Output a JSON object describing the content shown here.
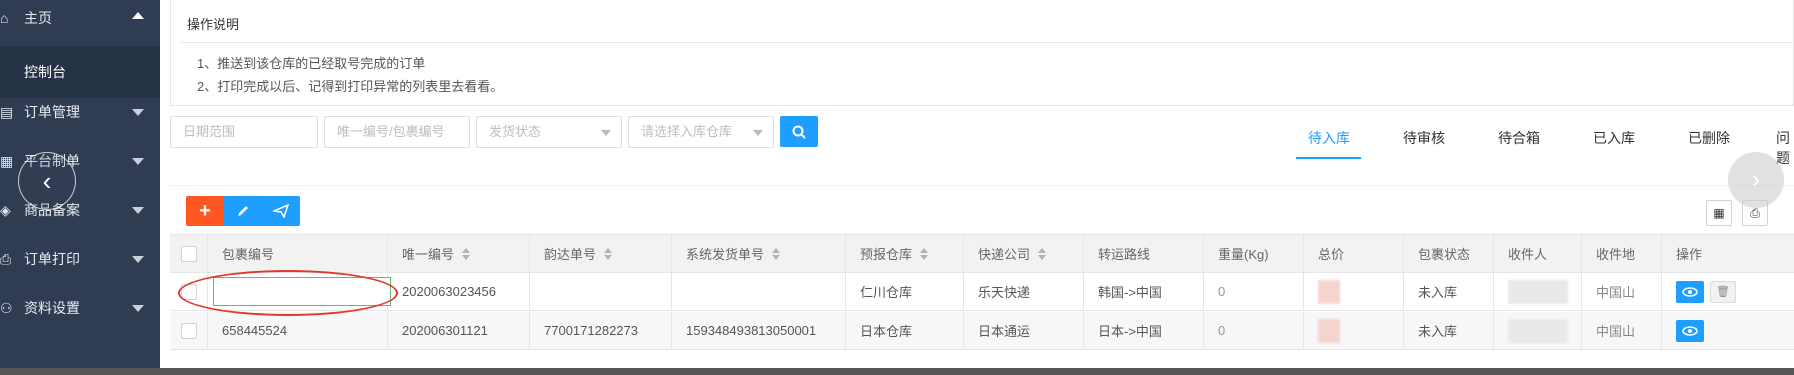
{
  "sidebar": {
    "items": [
      {
        "icon": "home-icon",
        "label": "主页",
        "expanded": true
      },
      {
        "icon": "list-icon",
        "label": "订单管理"
      },
      {
        "icon": "grid-icon",
        "label": "平台制单"
      },
      {
        "icon": "shield-icon",
        "label": "商品备案"
      },
      {
        "icon": "printer-icon",
        "label": "订单打印"
      },
      {
        "icon": "user-icon",
        "label": "资料设置"
      }
    ],
    "sub_item": "控制台"
  },
  "panel": {
    "title": "操作说明",
    "notes": [
      "1、推送到该仓库的已经取号完成的订单",
      "2、打印完成以后、记得到打印异常的列表里去看看。"
    ]
  },
  "filters": {
    "date_placeholder": "日期范围",
    "id_placeholder": "唯一编号/包裹编号",
    "status_placeholder": "发货状态",
    "warehouse_placeholder": "请选择入库仓库"
  },
  "tabs": [
    {
      "label": "待入库",
      "active": true
    },
    {
      "label": "待审核"
    },
    {
      "label": "待合箱"
    },
    {
      "label": "已入库"
    },
    {
      "label": "已删除"
    },
    {
      "label": "问题"
    }
  ],
  "table": {
    "headers": [
      "包裹编号",
      "唯一编号",
      "韵达单号",
      "系统发货单号",
      "预报仓库",
      "快递公司",
      "转运路线",
      "重量(Kg)",
      "总价",
      "包裹状态",
      "收件人",
      "收件地",
      "操作"
    ],
    "rows": [
      {
        "package": "",
        "uid": "2020063023456",
        "yunda": "",
        "sys": "",
        "warehouse": "仁川仓库",
        "courier": "乐天快递",
        "route": "韩国->中国",
        "weight": "0",
        "status": "未入库",
        "address": "中国山"
      },
      {
        "package": "658445524",
        "uid": "202006301121",
        "yunda": "7700171282273",
        "sys": "159348493813050001",
        "warehouse": "日本仓库",
        "courier": "日本通运",
        "route": "日本->中国",
        "weight": "0",
        "status": "未入库",
        "address": "中国山"
      }
    ]
  },
  "colors": {
    "sidebar_bg": "#2f3c52",
    "primary": "#1e9fff",
    "add": "#ff5722",
    "annotation": "#e03a2f"
  }
}
